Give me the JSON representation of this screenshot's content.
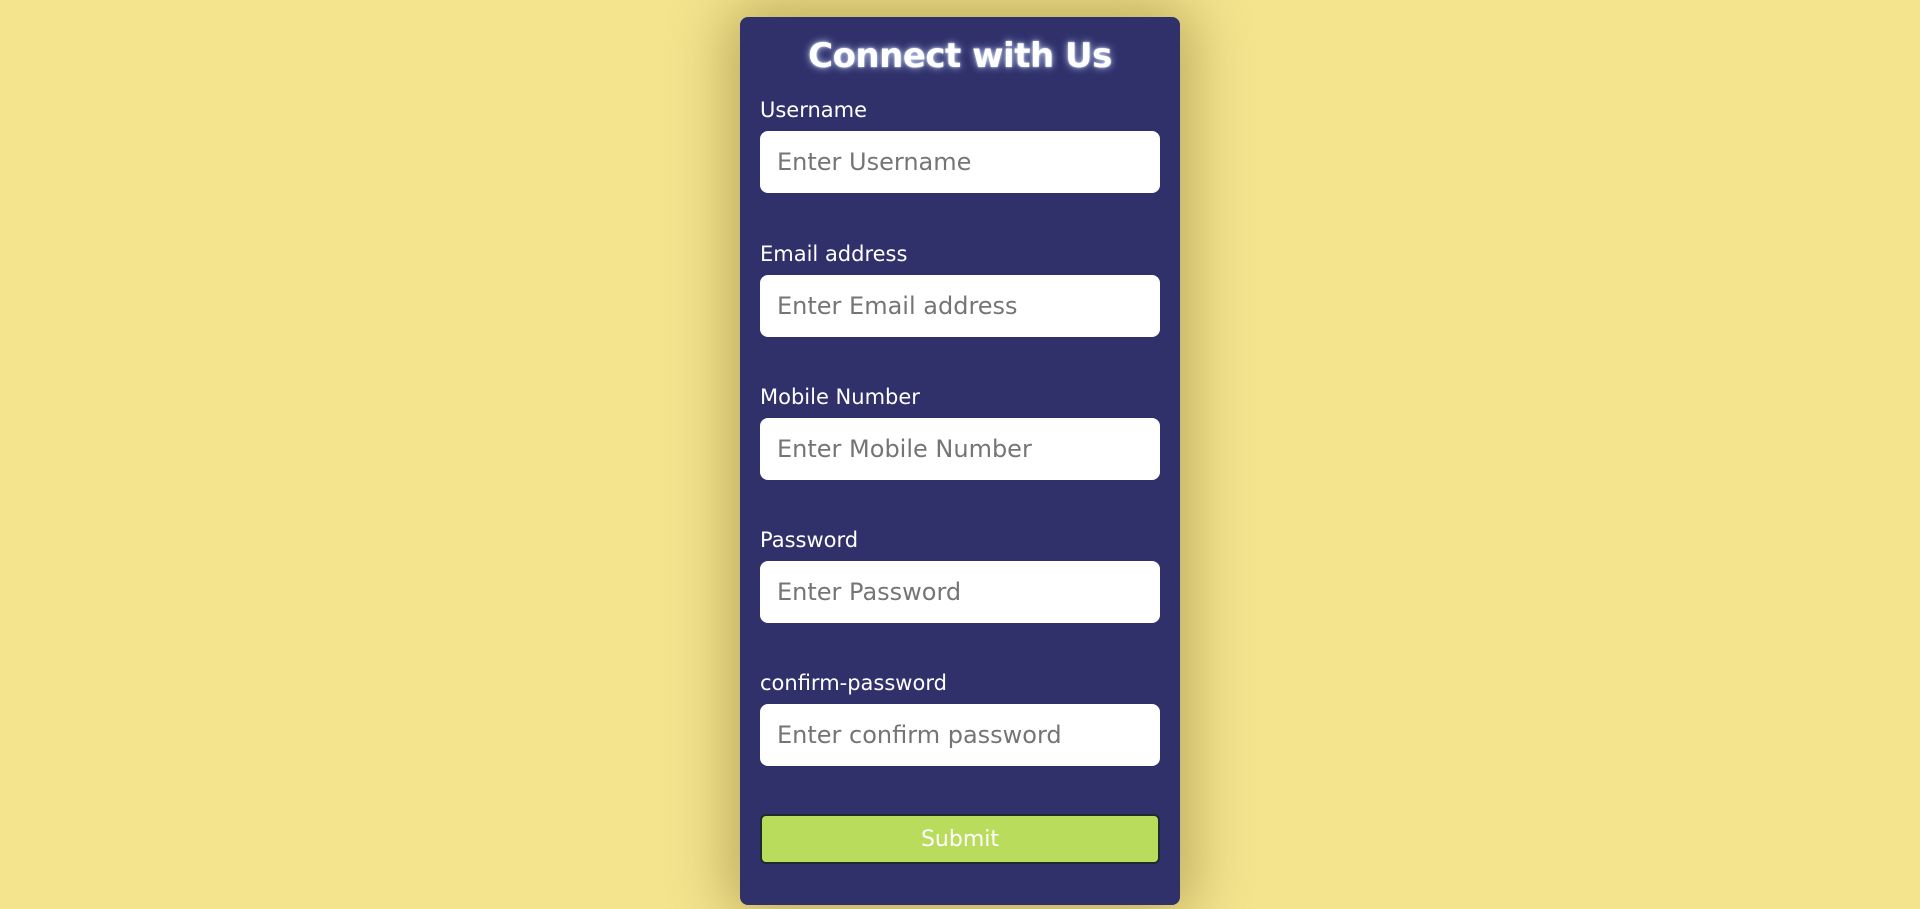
{
  "form": {
    "title": "Connect with Us",
    "fields": [
      {
        "label": "Username",
        "placeholder": "Enter Username",
        "value": ""
      },
      {
        "label": "Email address",
        "placeholder": "Enter Email address",
        "value": ""
      },
      {
        "label": "Mobile Number",
        "placeholder": "Enter Mobile Number",
        "value": ""
      },
      {
        "label": "Password",
        "placeholder": "Enter Password",
        "value": ""
      },
      {
        "label": "confirm-password",
        "placeholder": "Enter confirm password",
        "value": ""
      }
    ],
    "submit_label": "Submit"
  },
  "colors": {
    "page_background": "#f4e48e",
    "card_background": "#30316b",
    "submit_background": "#b9dc5c",
    "text": "#ffffff"
  }
}
